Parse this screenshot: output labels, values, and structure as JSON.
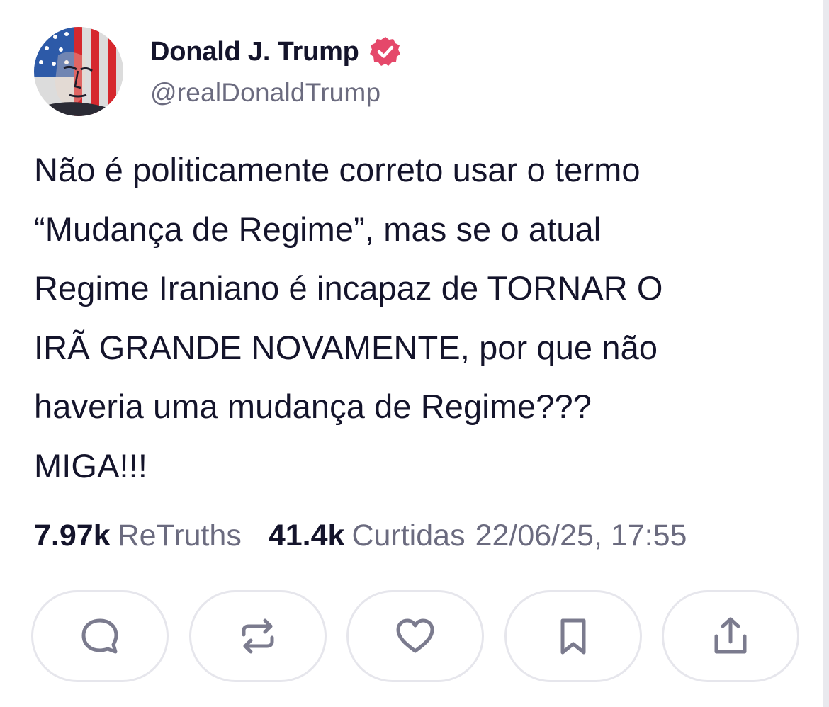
{
  "post": {
    "author": {
      "display_name": "Donald J. Trump",
      "handle": "@realDonaldTrump",
      "verified": true,
      "verified_color": "#e5486a"
    },
    "body_lines": [
      "Não é politicamente correto usar o termo",
      "“Mudança de Regime”, mas se o atual",
      "Regime Iraniano é incapaz de TORNAR O",
      "IRÃ GRANDE NOVAMENTE, por que não",
      "haveria uma mudança de Regime???",
      "MIGA!!!"
    ],
    "stats": {
      "retruths_count": "7.97k",
      "retruths_label": "ReTruths",
      "likes_count": "41.4k",
      "likes_label": "Curtidas",
      "timestamp": "22/06/25, 17:55"
    },
    "actions": [
      {
        "name": "reply",
        "icon": "comment-icon"
      },
      {
        "name": "retruth",
        "icon": "repost-icon"
      },
      {
        "name": "like",
        "icon": "heart-icon"
      },
      {
        "name": "bookmark",
        "icon": "bookmark-icon"
      },
      {
        "name": "share",
        "icon": "share-icon"
      }
    ]
  }
}
